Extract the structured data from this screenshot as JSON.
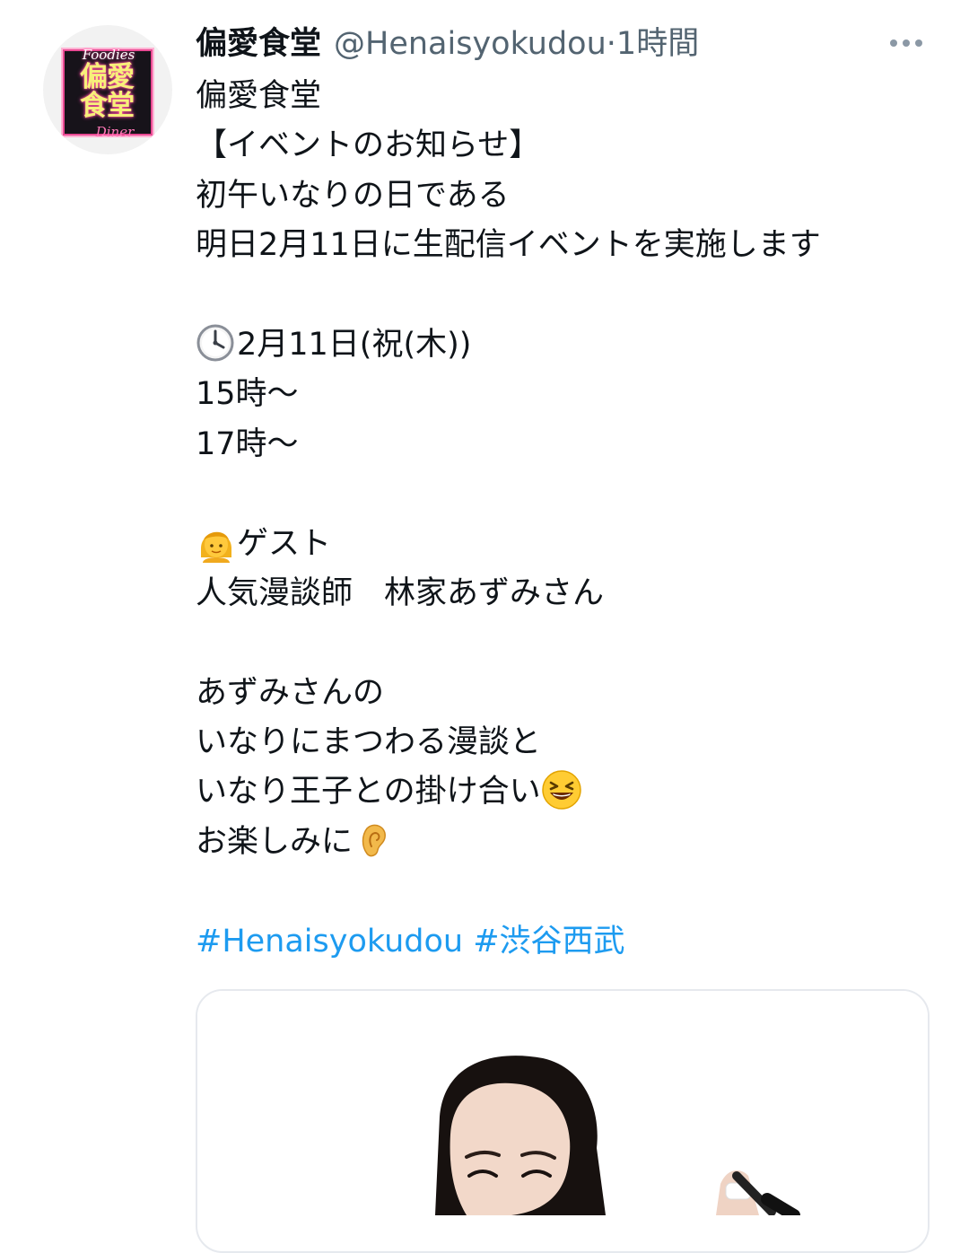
{
  "tweet": {
    "author": {
      "display_name": "偏愛食堂",
      "handle": "@Henaisyokudou",
      "avatar_logo": {
        "top_text": "Foodies",
        "main_text": "偏愛 食堂",
        "bottom_text": "Diner"
      }
    },
    "separator": "·",
    "time": "1時間",
    "more_icon": "more-horizontal-icon",
    "body": {
      "title": "偏愛食堂",
      "headline": "【イベントのお知らせ】",
      "intro_line1": "初午いなりの日である",
      "intro_line2": "明日2月11日に生配信イベントを実施します",
      "date_line": "2月11日(祝(木))",
      "time_1": "15時〜",
      "time_2": "17時〜",
      "guest_label": "ゲスト",
      "guest_name": "人気漫談師　林家あずみさん",
      "detail_line1": "あずみさんの",
      "detail_line2": "いなりにまつわる漫談と",
      "detail_line3": "いなり王子との掛け合い",
      "detail_line4": "お楽しみに"
    },
    "emoji": {
      "clock": "clock-icon",
      "guest": "woman-icon",
      "laughing": "grinning-squinting-face-icon",
      "ear": "ear-icon"
    },
    "hashtags": [
      "#Henaisyokudou",
      "#渋谷西武"
    ],
    "media": {
      "type": "photo",
      "subject": "person-photo"
    },
    "colors": {
      "text": "#0f1419",
      "secondary": "#536471",
      "link": "#1d9bf0",
      "border": "#e6e9ee"
    }
  }
}
